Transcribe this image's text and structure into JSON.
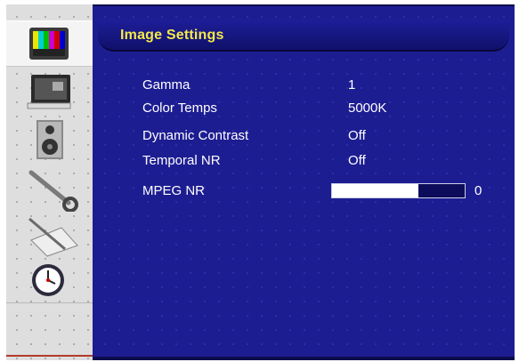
{
  "title": "Image Settings",
  "sidebar": {
    "items": [
      {
        "name": "image",
        "icon": "tv-test-pattern-icon",
        "selected": true
      },
      {
        "name": "screen",
        "icon": "monitor-icon",
        "selected": false
      },
      {
        "name": "audio",
        "icon": "speaker-icon",
        "selected": false
      },
      {
        "name": "setup",
        "icon": "wrench-icon",
        "selected": false
      },
      {
        "name": "options",
        "icon": "pen-notepad-icon",
        "selected": false
      },
      {
        "name": "clock",
        "icon": "clock-icon",
        "selected": false
      }
    ]
  },
  "settings": [
    {
      "label": "Gamma",
      "value": "1"
    },
    {
      "label": "Color Temps",
      "value": "5000K"
    },
    {
      "label": "Dynamic Contrast",
      "value": "Off"
    },
    {
      "label": "Temporal NR",
      "value": "Off"
    }
  ],
  "mpeg_nr": {
    "label": "MPEG NR",
    "value": "0",
    "level": 0.65
  },
  "colors": {
    "background": "#1d1d92",
    "title": "#f4e94a",
    "text": "#ffffff",
    "sidebar": "#dedede"
  }
}
